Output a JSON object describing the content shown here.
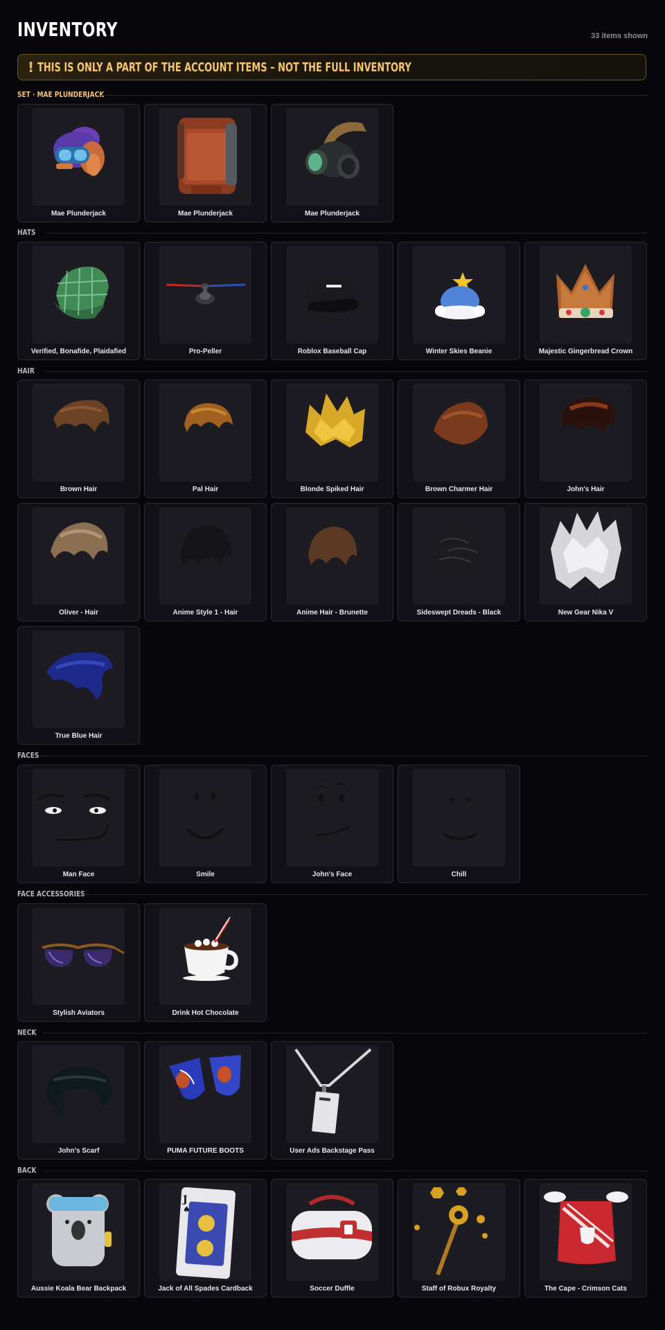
{
  "header": {
    "title": "INVENTORY",
    "count": "33 items shown"
  },
  "warning": {
    "icon": "!",
    "text": "THIS IS ONLY A PART OF THE ACCOUNT ITEMS – NOT THE FULL INVENTORY",
    "accent": "#f2b544"
  },
  "sections": [
    {
      "label": "SET · MAE PLUNDERJACK",
      "items": [
        {
          "name": "Mae Plunderjack",
          "icon": "helmet-icon"
        },
        {
          "name": "Mae Plunderjack",
          "icon": "backpack-icon"
        },
        {
          "name": "Mae Plunderjack",
          "icon": "gas-mask-icon"
        }
      ]
    },
    {
      "label": "HATS",
      "items": [
        {
          "name": "Verified, Bonafide, Plaidafied",
          "icon": "plaid-cap-icon"
        },
        {
          "name": "Pro-Peller",
          "icon": "propeller-icon"
        },
        {
          "name": "Roblox Baseball Cap",
          "icon": "baseball-cap-icon"
        },
        {
          "name": "Winter Skies Beanie",
          "icon": "beanie-icon"
        },
        {
          "name": "Majestic Gingerbread Crown",
          "icon": "crown-icon"
        }
      ]
    },
    {
      "label": "HAIR",
      "items": [
        {
          "name": "Brown Hair",
          "icon": "hair-icon"
        },
        {
          "name": "Pal Hair",
          "icon": "hair-icon"
        },
        {
          "name": "Blonde Spiked Hair",
          "icon": "hair-icon"
        },
        {
          "name": "Brown Charmer Hair",
          "icon": "hair-icon"
        },
        {
          "name": "John's Hair",
          "icon": "hair-icon"
        },
        {
          "name": "Oliver - Hair",
          "icon": "hair-icon"
        },
        {
          "name": "Anime Style 1 - Hair",
          "icon": "hair-icon"
        },
        {
          "name": "Anime Hair - Brunette",
          "icon": "hair-icon"
        },
        {
          "name": "Sideswept Dreads - Black",
          "icon": "hair-icon"
        },
        {
          "name": "New Gear Nika V",
          "icon": "hair-icon"
        },
        {
          "name": "True Blue Hair",
          "icon": "hair-icon"
        }
      ]
    },
    {
      "label": "FACES",
      "items": [
        {
          "name": "Man Face",
          "icon": "face-icon"
        },
        {
          "name": "Smile",
          "icon": "face-icon"
        },
        {
          "name": "John's Face",
          "icon": "face-icon"
        },
        {
          "name": "Chill",
          "icon": "face-icon"
        }
      ]
    },
    {
      "label": "FACE ACCESSORIES",
      "items": [
        {
          "name": "Stylish Aviators",
          "icon": "sunglasses-icon"
        },
        {
          "name": "Drink Hot Chocolate",
          "icon": "mug-icon"
        }
      ]
    },
    {
      "label": "NECK",
      "items": [
        {
          "name": "John's Scarf",
          "icon": "scarf-icon"
        },
        {
          "name": "PUMA FUTURE BOOTS",
          "icon": "boots-icon"
        },
        {
          "name": "User Ads Backstage Pass",
          "icon": "lanyard-icon"
        }
      ]
    },
    {
      "label": "BACK",
      "items": [
        {
          "name": "Aussie Koala Bear Backpack",
          "icon": "koala-backpack-icon"
        },
        {
          "name": "Jack of All Spades Cardback",
          "icon": "playing-card-icon"
        },
        {
          "name": "Soccer Duffle",
          "icon": "duffle-bag-icon"
        },
        {
          "name": "Staff of Robux Royalty",
          "icon": "staff-icon"
        },
        {
          "name": "The Cape - Crimson Cats",
          "icon": "cape-icon"
        }
      ]
    }
  ]
}
